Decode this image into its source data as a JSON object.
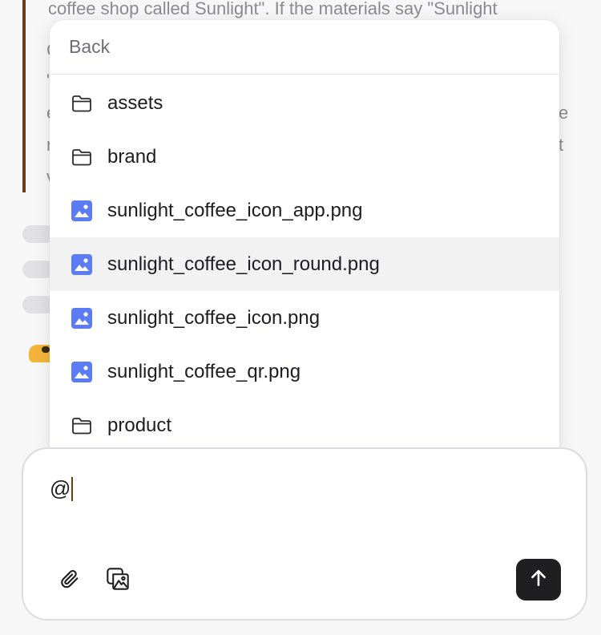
{
  "background": {
    "quote_text": "coffee shop called Sunlight\". If the materials say \"Sunlight",
    "right_fragments": [
      "e",
      "t"
    ],
    "left_fragments": [
      "C",
      "\"",
      "e",
      "r",
      "v"
    ]
  },
  "menu": {
    "back_label": "Back",
    "items": [
      {
        "label": "assets",
        "icon": "folder-icon"
      },
      {
        "label": "brand",
        "icon": "folder-icon"
      },
      {
        "label": "sunlight_coffee_icon_app.png",
        "icon": "image-file-icon"
      },
      {
        "label": "sunlight_coffee_icon_round.png",
        "icon": "image-file-icon",
        "highlighted": true
      },
      {
        "label": "sunlight_coffee_icon.png",
        "icon": "image-file-icon"
      },
      {
        "label": "sunlight_coffee_qr.png",
        "icon": "image-file-icon"
      },
      {
        "label": "product",
        "icon": "folder-icon"
      }
    ]
  },
  "composer": {
    "input_value": "@",
    "attach_icon": "paperclip-icon",
    "image_icon": "image-gallery-icon",
    "send_icon": "arrow-up-icon"
  },
  "colors": {
    "accent_quote": "#6b3f12",
    "image_icon": "#5b7cf5",
    "send_bg": "#1f1f21",
    "highlight": "#f2f2f3"
  }
}
